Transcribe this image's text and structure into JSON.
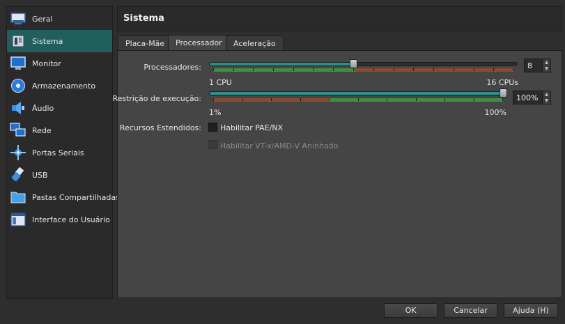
{
  "sidebar": {
    "items": [
      {
        "label": "Geral",
        "icon": "monitor-general-icon"
      },
      {
        "label": "Sistema",
        "icon": "chip-icon"
      },
      {
        "label": "Monitor",
        "icon": "display-icon"
      },
      {
        "label": "Armazenamento",
        "icon": "disk-icon"
      },
      {
        "label": "Áudio",
        "icon": "speaker-icon"
      },
      {
        "label": "Rede",
        "icon": "network-icon"
      },
      {
        "label": "Portas Seriais",
        "icon": "serial-port-icon"
      },
      {
        "label": "USB",
        "icon": "usb-icon"
      },
      {
        "label": "Pastas Compartilhadas",
        "icon": "folder-icon"
      },
      {
        "label": "Interface do Usuário",
        "icon": "ui-window-icon"
      }
    ],
    "active_index": 1
  },
  "header": {
    "title": "Sistema"
  },
  "tabs": [
    {
      "label": "Placa-Mãe",
      "active": false
    },
    {
      "label": "Processador",
      "active": true
    },
    {
      "label": "Aceleração",
      "active": false
    }
  ],
  "processor": {
    "processors_label": "Processadores:",
    "processors_value": "8",
    "processors_min_label": "1 CPU",
    "processors_max_label": "16 CPUs",
    "processors_min": 1,
    "processors_max": 16,
    "processors_current": 8,
    "cap_label": "Restrição de execução:",
    "cap_value": "100%",
    "cap_min_label": "1%",
    "cap_max_label": "100%",
    "cap_current_fraction": 1.0,
    "extended_label": "Recursos Estendidos:",
    "pae_label": "Habilitar PAE/NX",
    "pae_checked": false,
    "nested_label": "Habilitar VT-x/AMD-V Aninhado",
    "nested_enabled": false
  },
  "footer": {
    "ok": "OK",
    "cancel": "Cancelar",
    "help": "Ajuda (H)"
  },
  "colors": {
    "accent": "#215e5e",
    "slider_fill": "#2f8f8f",
    "zone_green": "#3f8f3f",
    "zone_red": "#8a4a32"
  }
}
